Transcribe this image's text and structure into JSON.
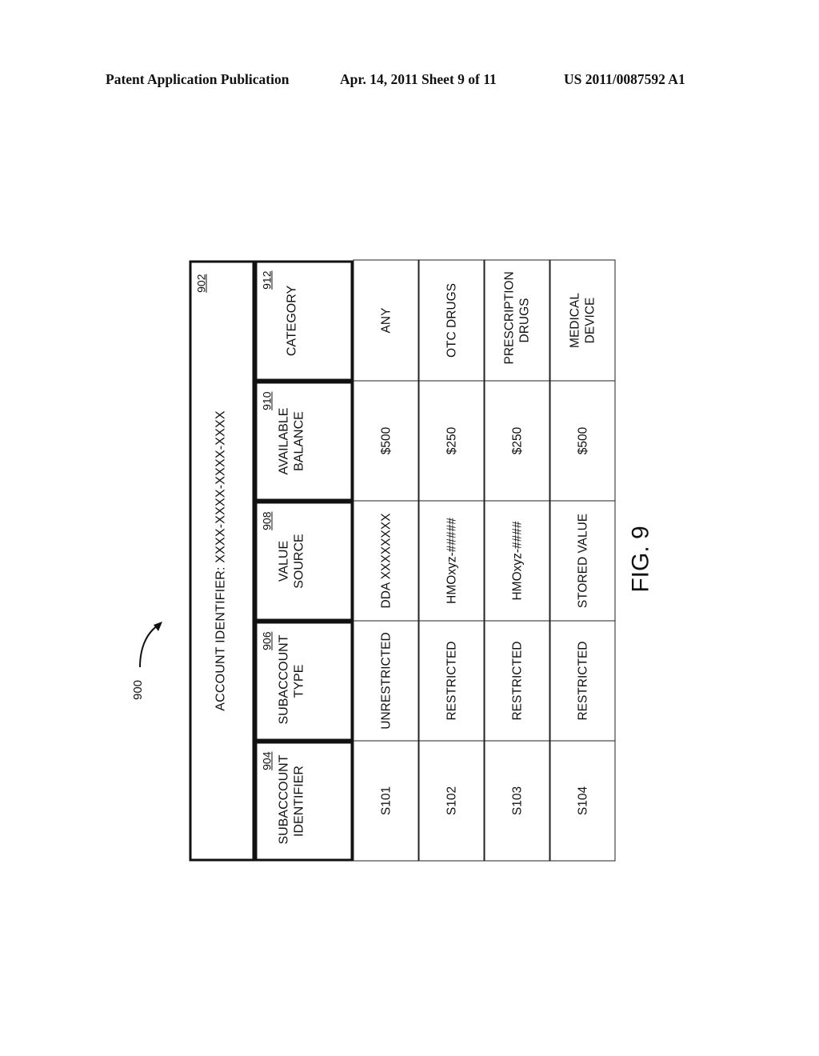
{
  "header": {
    "left": "Patent Application Publication",
    "middle": "Apr. 14, 2011  Sheet 9 of 11",
    "right": "US 2011/0087592 A1"
  },
  "figure": {
    "reference": "900",
    "label": "FIG. 9"
  },
  "table": {
    "account": {
      "text": "ACCOUNT IDENTIFIER: XXXX-XXXX-XXXX-XXXX",
      "ref": "902"
    },
    "columns": [
      {
        "label": "SUBACCOUNT IDENTIFIER",
        "ref": "904"
      },
      {
        "label": "SUBACCOUNT TYPE",
        "ref": "906"
      },
      {
        "label": "VALUE SOURCE",
        "ref": "908"
      },
      {
        "label": "AVAILABLE BALANCE",
        "ref": "910"
      },
      {
        "label": "CATEGORY",
        "ref": "912"
      }
    ],
    "rows": [
      [
        "S101",
        "UNRESTRICTED",
        "DDA XXXXXXXX",
        "$500",
        "ANY"
      ],
      [
        "S102",
        "RESTRICTED",
        "HMOxyz-#####",
        "$250",
        "OTC DRUGS"
      ],
      [
        "S103",
        "RESTRICTED",
        "HMOxyz-####",
        "$250",
        "PRESCRIPTION DRUGS"
      ],
      [
        "S104",
        "RESTRICTED",
        "STORED VALUE",
        "$500",
        "MEDICAL DEVICE"
      ]
    ]
  }
}
